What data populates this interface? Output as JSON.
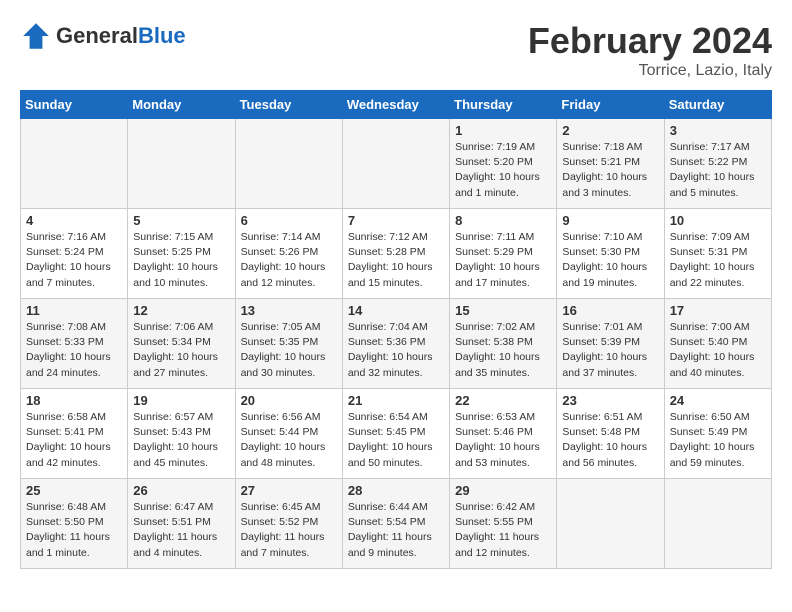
{
  "logo": {
    "general": "General",
    "blue": "Blue"
  },
  "header": {
    "title": "February 2024",
    "subtitle": "Torrice, Lazio, Italy"
  },
  "days_of_week": [
    "Sunday",
    "Monday",
    "Tuesday",
    "Wednesday",
    "Thursday",
    "Friday",
    "Saturday"
  ],
  "weeks": [
    [
      {
        "day": "",
        "info": ""
      },
      {
        "day": "",
        "info": ""
      },
      {
        "day": "",
        "info": ""
      },
      {
        "day": "",
        "info": ""
      },
      {
        "day": "1",
        "info": "Sunrise: 7:19 AM\nSunset: 5:20 PM\nDaylight: 10 hours and 1 minute."
      },
      {
        "day": "2",
        "info": "Sunrise: 7:18 AM\nSunset: 5:21 PM\nDaylight: 10 hours and 3 minutes."
      },
      {
        "day": "3",
        "info": "Sunrise: 7:17 AM\nSunset: 5:22 PM\nDaylight: 10 hours and 5 minutes."
      }
    ],
    [
      {
        "day": "4",
        "info": "Sunrise: 7:16 AM\nSunset: 5:24 PM\nDaylight: 10 hours and 7 minutes."
      },
      {
        "day": "5",
        "info": "Sunrise: 7:15 AM\nSunset: 5:25 PM\nDaylight: 10 hours and 10 minutes."
      },
      {
        "day": "6",
        "info": "Sunrise: 7:14 AM\nSunset: 5:26 PM\nDaylight: 10 hours and 12 minutes."
      },
      {
        "day": "7",
        "info": "Sunrise: 7:12 AM\nSunset: 5:28 PM\nDaylight: 10 hours and 15 minutes."
      },
      {
        "day": "8",
        "info": "Sunrise: 7:11 AM\nSunset: 5:29 PM\nDaylight: 10 hours and 17 minutes."
      },
      {
        "day": "9",
        "info": "Sunrise: 7:10 AM\nSunset: 5:30 PM\nDaylight: 10 hours and 19 minutes."
      },
      {
        "day": "10",
        "info": "Sunrise: 7:09 AM\nSunset: 5:31 PM\nDaylight: 10 hours and 22 minutes."
      }
    ],
    [
      {
        "day": "11",
        "info": "Sunrise: 7:08 AM\nSunset: 5:33 PM\nDaylight: 10 hours and 24 minutes."
      },
      {
        "day": "12",
        "info": "Sunrise: 7:06 AM\nSunset: 5:34 PM\nDaylight: 10 hours and 27 minutes."
      },
      {
        "day": "13",
        "info": "Sunrise: 7:05 AM\nSunset: 5:35 PM\nDaylight: 10 hours and 30 minutes."
      },
      {
        "day": "14",
        "info": "Sunrise: 7:04 AM\nSunset: 5:36 PM\nDaylight: 10 hours and 32 minutes."
      },
      {
        "day": "15",
        "info": "Sunrise: 7:02 AM\nSunset: 5:38 PM\nDaylight: 10 hours and 35 minutes."
      },
      {
        "day": "16",
        "info": "Sunrise: 7:01 AM\nSunset: 5:39 PM\nDaylight: 10 hours and 37 minutes."
      },
      {
        "day": "17",
        "info": "Sunrise: 7:00 AM\nSunset: 5:40 PM\nDaylight: 10 hours and 40 minutes."
      }
    ],
    [
      {
        "day": "18",
        "info": "Sunrise: 6:58 AM\nSunset: 5:41 PM\nDaylight: 10 hours and 42 minutes."
      },
      {
        "day": "19",
        "info": "Sunrise: 6:57 AM\nSunset: 5:43 PM\nDaylight: 10 hours and 45 minutes."
      },
      {
        "day": "20",
        "info": "Sunrise: 6:56 AM\nSunset: 5:44 PM\nDaylight: 10 hours and 48 minutes."
      },
      {
        "day": "21",
        "info": "Sunrise: 6:54 AM\nSunset: 5:45 PM\nDaylight: 10 hours and 50 minutes."
      },
      {
        "day": "22",
        "info": "Sunrise: 6:53 AM\nSunset: 5:46 PM\nDaylight: 10 hours and 53 minutes."
      },
      {
        "day": "23",
        "info": "Sunrise: 6:51 AM\nSunset: 5:48 PM\nDaylight: 10 hours and 56 minutes."
      },
      {
        "day": "24",
        "info": "Sunrise: 6:50 AM\nSunset: 5:49 PM\nDaylight: 10 hours and 59 minutes."
      }
    ],
    [
      {
        "day": "25",
        "info": "Sunrise: 6:48 AM\nSunset: 5:50 PM\nDaylight: 11 hours and 1 minute."
      },
      {
        "day": "26",
        "info": "Sunrise: 6:47 AM\nSunset: 5:51 PM\nDaylight: 11 hours and 4 minutes."
      },
      {
        "day": "27",
        "info": "Sunrise: 6:45 AM\nSunset: 5:52 PM\nDaylight: 11 hours and 7 minutes."
      },
      {
        "day": "28",
        "info": "Sunrise: 6:44 AM\nSunset: 5:54 PM\nDaylight: 11 hours and 9 minutes."
      },
      {
        "day": "29",
        "info": "Sunrise: 6:42 AM\nSunset: 5:55 PM\nDaylight: 11 hours and 12 minutes."
      },
      {
        "day": "",
        "info": ""
      },
      {
        "day": "",
        "info": ""
      }
    ]
  ]
}
